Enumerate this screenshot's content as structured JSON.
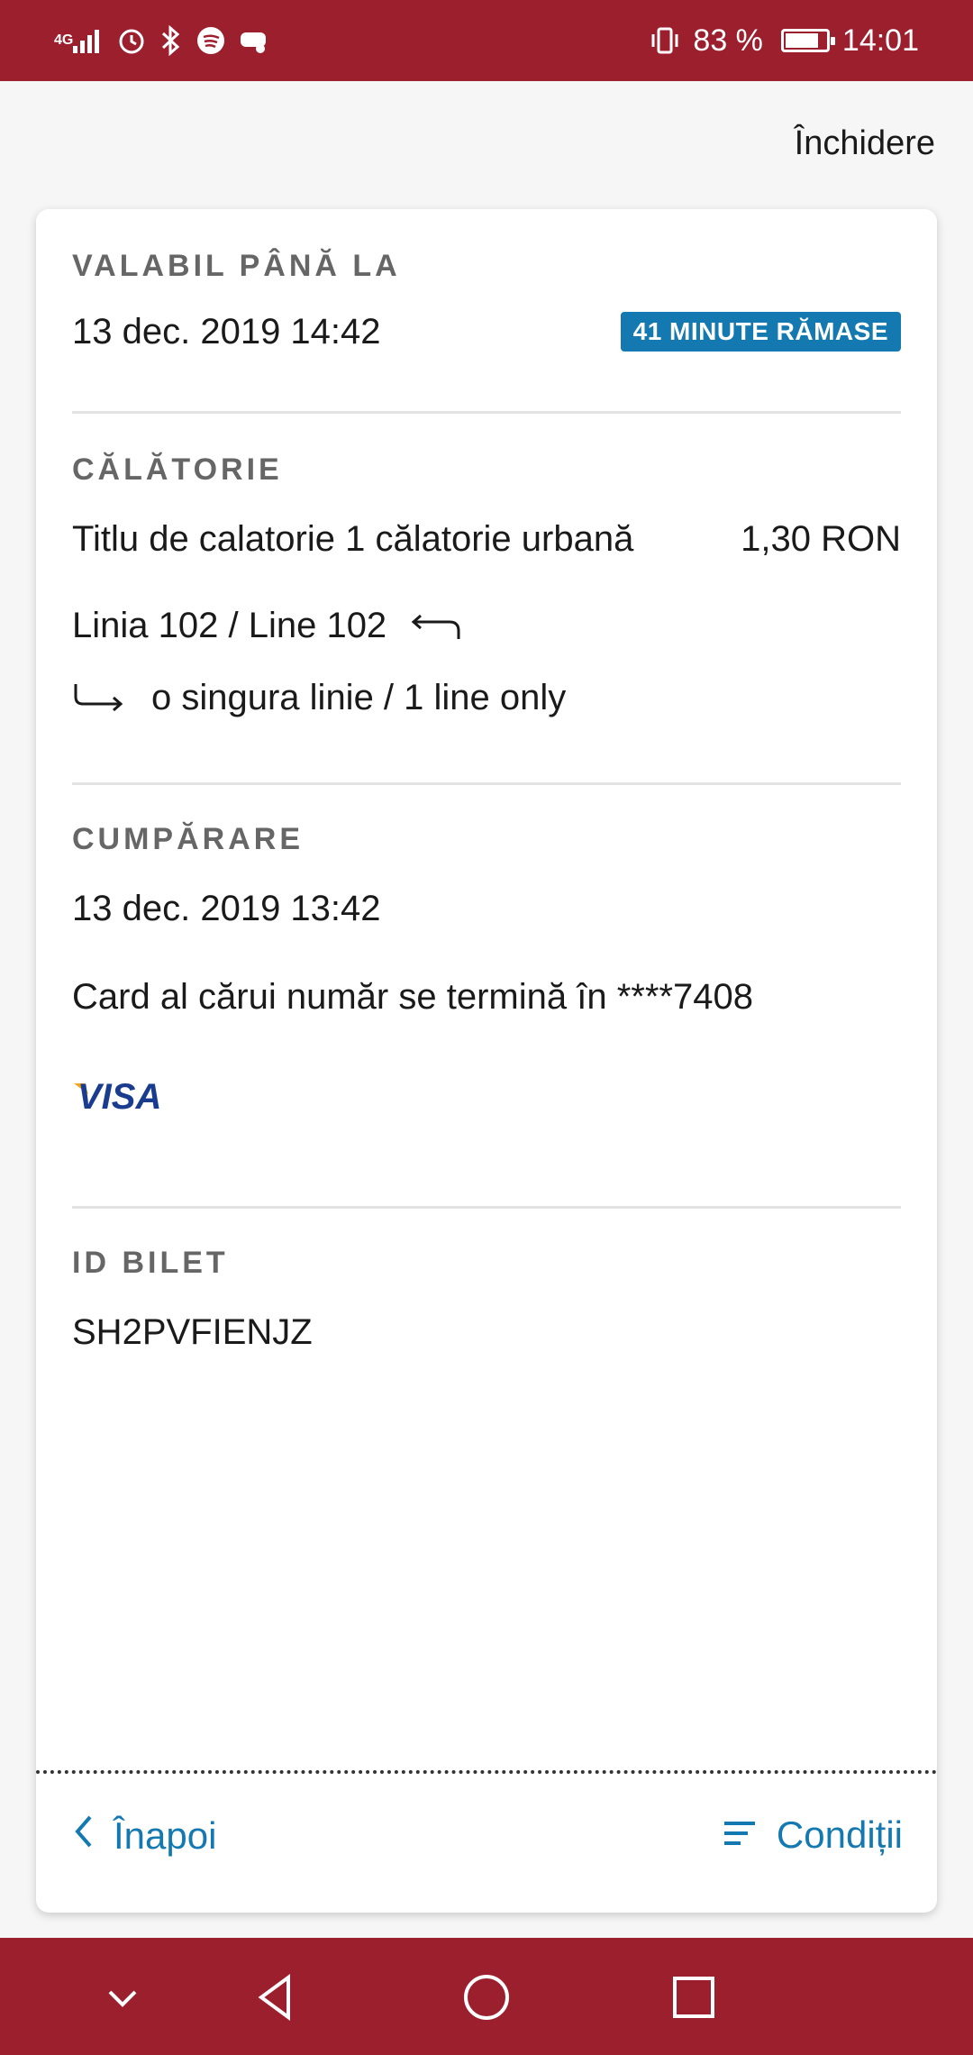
{
  "status_bar": {
    "network": "4G",
    "battery_percent_text": "83 %",
    "battery_level": 0.83,
    "time": "14:01",
    "icons": [
      "signal-icon",
      "alarm-icon",
      "bluetooth-icon",
      "spotify-icon",
      "game-icon",
      "vibrate-icon",
      "battery-icon"
    ]
  },
  "header": {
    "close_label": "Închidere"
  },
  "validity": {
    "label": "VALABIL PÂNĂ LA",
    "date": "13 dec. 2019 14:42",
    "badge": "41 MINUTE RĂMASE",
    "badge_color": "#1479b0"
  },
  "trip": {
    "label": "CĂLĂTORIE",
    "ticket_name": "Titlu de calatorie 1 călatorie urbană",
    "price": "1,30 RON",
    "line": "Linia 102 / Line 102",
    "restriction": "o singura linie / 1 line only"
  },
  "purchase": {
    "label": "CUMPĂRARE",
    "date": "13 dec. 2019 13:42",
    "card_text": "Card al cărui număr se termină în ****7408",
    "card_brand": "VISA"
  },
  "ticket_id": {
    "label": "ID BILET",
    "value": "SH2PVFIENJZ"
  },
  "footer": {
    "back_label": "Înapoi",
    "conditions_label": "Condiții"
  },
  "colors": {
    "brand": "#9c1f2e",
    "accent": "#1479b0"
  }
}
